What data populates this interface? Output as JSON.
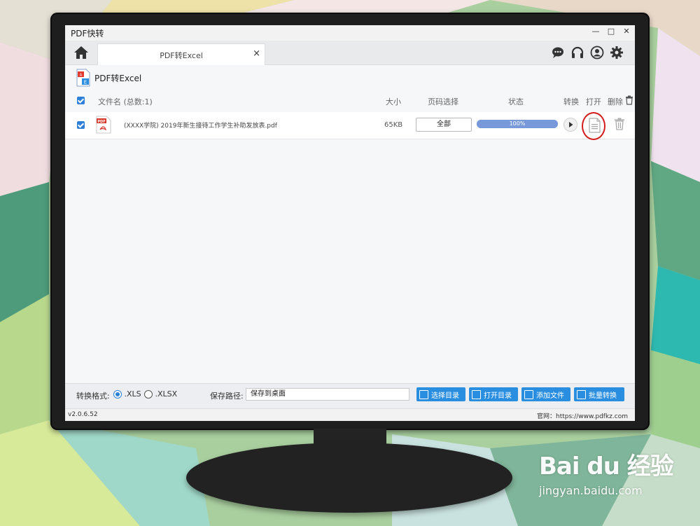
{
  "window": {
    "title": "PDF快转"
  },
  "tab": {
    "label": "PDF转Excel",
    "close": "×"
  },
  "heading": {
    "title": "PDF转Excel"
  },
  "table": {
    "header": {
      "filename": "文件名 (总数:1)",
      "size": "大小",
      "page_select": "页码选择",
      "status": "状态",
      "convert": "转换",
      "open": "打开",
      "delete": "删除"
    },
    "rows": [
      {
        "filename": "(XXXX学院) 2019年新生接待工作学生补助发放表.pdf",
        "size": "65KB",
        "page_range": "全部",
        "progress": 100,
        "progress_text": "100%"
      }
    ]
  },
  "bottom": {
    "format_label": "转换格式:",
    "format_options": [
      ".XLS",
      ".XLSX"
    ],
    "format_selected": ".XLS",
    "save_path_label": "保存路径:",
    "save_path_value": "保存到桌面",
    "buttons": {
      "choose_dir": "选择目录",
      "open_dir": "打开目录",
      "add_file": "添加文件",
      "batch_convert": "批量转换"
    }
  },
  "status_bar": {
    "version": "v2.0.6.52",
    "website": "官网：https://www.pdfkz.com"
  },
  "watermark": {
    "main": "Bai du 经验",
    "sub": "jingyan.baidu.com"
  },
  "colors": {
    "accent": "#2a8ee0",
    "progress": "#7799d9",
    "annotation": "#d41a1a"
  }
}
